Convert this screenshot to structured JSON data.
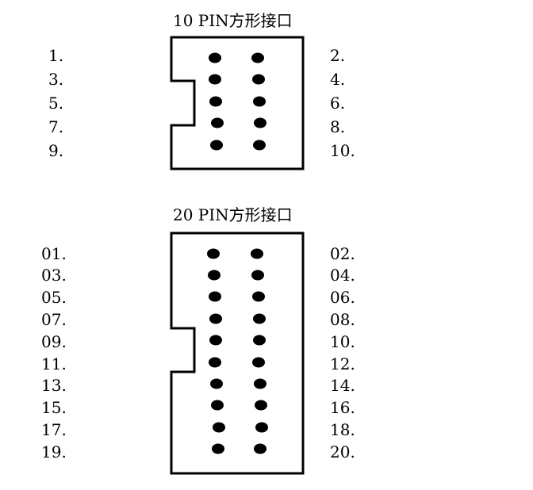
{
  "connectors": [
    {
      "title": "10 PIN方形接口",
      "left_labels": [
        "1.",
        "3.",
        "5.",
        "7.",
        "9."
      ],
      "right_labels": [
        "2.",
        "4.",
        "6.",
        "8.",
        "10."
      ],
      "pin_rows": 5
    },
    {
      "title": "20 PIN方形接口",
      "left_labels": [
        "01.",
        "03.",
        "05.",
        "07.",
        "09.",
        "11.",
        "13.",
        "15.",
        "17.",
        "19."
      ],
      "right_labels": [
        "02.",
        "04.",
        "06.",
        "08.",
        "10.",
        "12.",
        "14.",
        "16.",
        "18.",
        "20."
      ],
      "pin_rows": 10
    }
  ],
  "colors": {
    "stroke": "#000000",
    "pin": "#000000",
    "background": "#ffffff"
  }
}
